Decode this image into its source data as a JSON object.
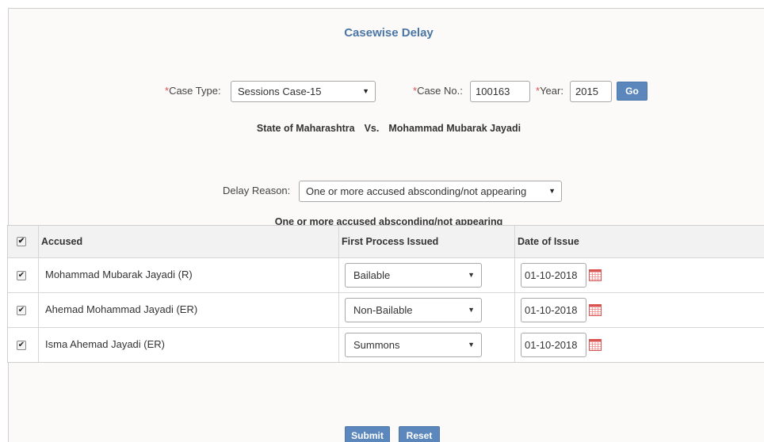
{
  "title": "Casewise Delay",
  "required_mark": "*",
  "case_type": {
    "label": "Case Type:",
    "value": "Sessions Case-15"
  },
  "case_no": {
    "label": "Case No.:",
    "value": "100163"
  },
  "year": {
    "label": "Year:",
    "value": "2015"
  },
  "go_button": "Go",
  "parties": {
    "petitioner": "State of Maharashtra",
    "vs": "Vs.",
    "respondent": "Mohammad Mubarak Jayadi"
  },
  "delay_reason": {
    "label": "Delay Reason:",
    "value": "One or more accused absconding/not appearing"
  },
  "reason_heading": "One or more accused absconding/not appearing",
  "table": {
    "headers": {
      "accused": "Accused",
      "first_process": "First Process Issued",
      "date_of_issue": "Date of Issue"
    },
    "rows": [
      {
        "accused": "Mohammad Mubarak Jayadi (R)",
        "process": "Bailable",
        "date": "01-10-2018",
        "checked": true
      },
      {
        "accused": "Ahemad Mohammad Jayadi (ER)",
        "process": "Non-Bailable",
        "date": "01-10-2018",
        "checked": true
      },
      {
        "accused": "Isma Ahemad Jayadi (ER)",
        "process": "Summons",
        "date": "01-10-2018",
        "checked": true
      }
    ]
  },
  "submit_button": "Submit",
  "reset_button": "Reset",
  "icons": {
    "dropdown": "chevron-down-icon",
    "checkbox": "checkbox-checked-icon",
    "calendar": "calendar-icon"
  },
  "colors": {
    "title": "#4a76a6",
    "button": "#5b87bd",
    "required": "#d9534f",
    "calendar": "#d9534f"
  }
}
